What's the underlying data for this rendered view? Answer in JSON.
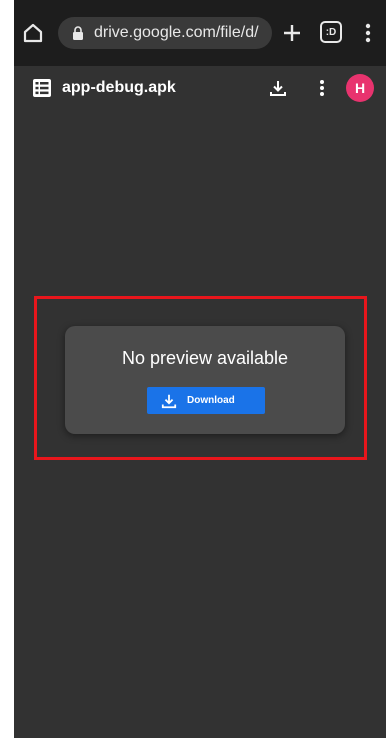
{
  "browser": {
    "url": "drive.google.com/file/d/",
    "tabs_label": ":D"
  },
  "app_bar": {
    "file_name": "app-debug.apk",
    "avatar_initial": "H"
  },
  "preview": {
    "message": "No preview available",
    "download_label": "Download"
  },
  "colors": {
    "browser_bar": "#1d1d1d",
    "background": "#323232",
    "card": "#4b4b4b",
    "accent": "#1a73e8",
    "avatar": "#e8336e",
    "highlight": "#e8161c"
  },
  "icons": [
    "home-icon",
    "lock-icon",
    "plus-icon",
    "tabs-icon",
    "more-vert-icon",
    "file-list-icon",
    "download-icon"
  ]
}
